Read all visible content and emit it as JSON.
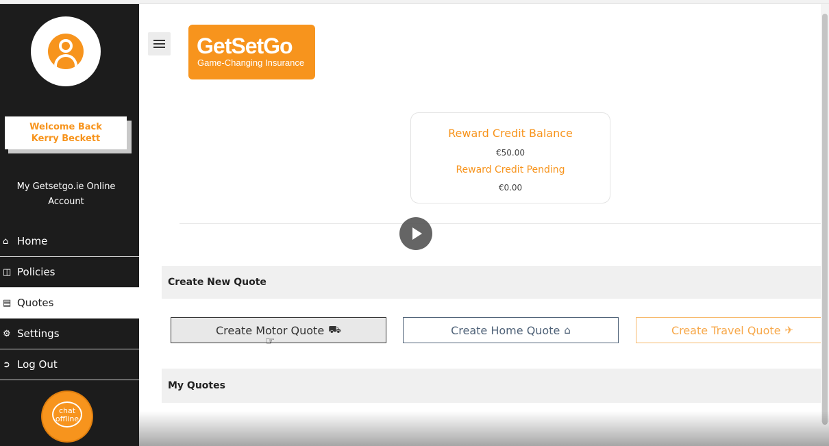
{
  "sidebar": {
    "welcome_line1": "Welcome Back",
    "welcome_line2": "Kerry Beckett",
    "account_label": "My Getsetgo.ie Online Account",
    "items": [
      {
        "label": "Home",
        "icon": "home-icon"
      },
      {
        "label": "Policies",
        "icon": "folder-icon"
      },
      {
        "label": "Quotes",
        "icon": "document-icon"
      },
      {
        "label": "Settings",
        "icon": "gears-icon"
      },
      {
        "label": "Log Out",
        "icon": "logout-icon"
      }
    ],
    "active_item": "Quotes",
    "chat": {
      "line1": "chat",
      "line2": "offline"
    }
  },
  "logo": {
    "brand": "GetSetGo",
    "tagline": "Game-Changing Insurance"
  },
  "reward": {
    "balance_label": "Reward Credit Balance",
    "balance_value": "€50.00",
    "pending_label": "Reward Credit Pending",
    "pending_value": "€0.00"
  },
  "sections": {
    "create_new_quote": "Create New Quote",
    "my_quotes": "My Quotes"
  },
  "quote_buttons": {
    "motor": {
      "label": "Create Motor Quote",
      "icon": "car-icon"
    },
    "home": {
      "label": "Create Home Quote",
      "icon": "home-icon"
    },
    "travel": {
      "label": "Create Travel Quote",
      "icon": "plane-icon"
    }
  },
  "colors": {
    "brand_orange": "#f7941d",
    "sidebar_bg": "#1c1c1c",
    "home_blue": "#4f6278"
  }
}
